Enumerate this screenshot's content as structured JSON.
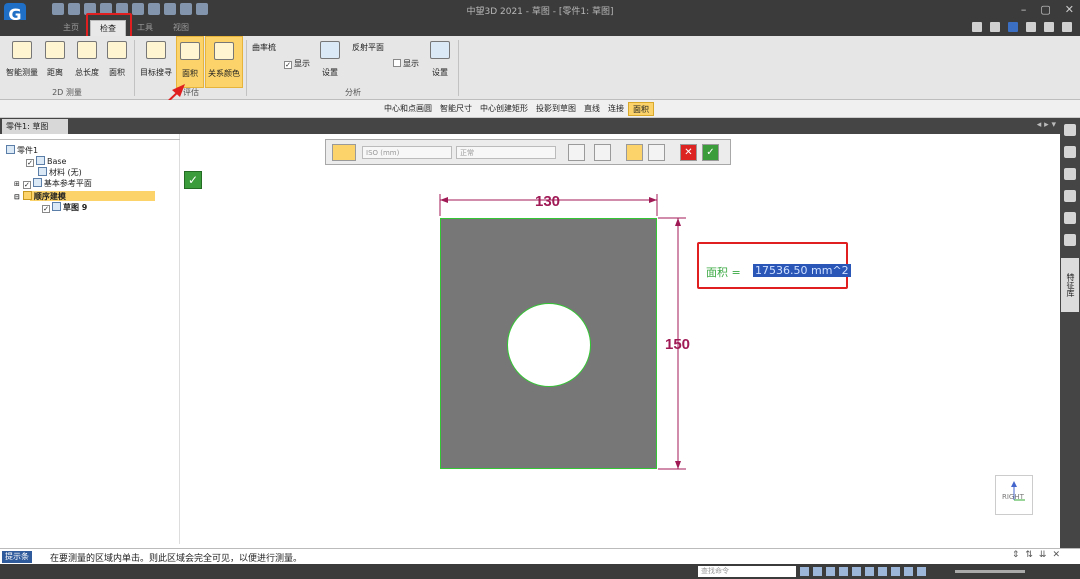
{
  "app": {
    "title": "中望3D 2021 - 草图 - [零件1: 草图]",
    "logo_text": "G",
    "tabs": [
      "主页",
      "检查",
      "工具",
      "视图"
    ],
    "active_tab": "检查"
  },
  "ribbon": {
    "measure_group": {
      "label": "2D 测量",
      "buttons": [
        "智能测量",
        "距离",
        "总长度",
        "面积"
      ]
    },
    "eval_group": {
      "label": "评估",
      "buttons": [
        "目标搜寻",
        "面积",
        "关系颜色"
      ]
    },
    "analysis_group": {
      "label": "分析",
      "curvature_label": "曲率梳",
      "curvature_show": "显示",
      "curvature_settings": "设置",
      "reflect_label": "反射平面",
      "reflect_show": "显示",
      "reflect_settings": "设置"
    }
  },
  "command_bar": {
    "items": [
      "中心和点画圆",
      "智能尺寸",
      "中心创建矩形",
      "投影到草图",
      "直线",
      "连接",
      "面积"
    ],
    "active": "面积"
  },
  "document": {
    "tab_label": "零件1: 草图"
  },
  "tree": {
    "root": "零件1",
    "items": [
      {
        "label": "Base"
      },
      {
        "label": "材料 (无)"
      },
      {
        "label": "基本参考平面"
      },
      {
        "label": "顺序建模"
      },
      {
        "label": "草图 9"
      }
    ]
  },
  "float_toolbar": {
    "standard_select": "ISO (mm)",
    "style_select": "正常"
  },
  "canvas": {
    "dimension_width": "130",
    "dimension_height": "150",
    "area_label": "面积 =",
    "area_value": "17536.50 mm^2",
    "view_label": "RIGHT"
  },
  "right_panel": {
    "feature_lib": "特征库"
  },
  "prompt": {
    "tag": "提示条",
    "text": "在要测量的区域内单击。则此区域会完全可见，以便进行测量。"
  },
  "status": {
    "command_search_placeholder": "查找命令"
  },
  "colors": {
    "highlight": "#fbd36a",
    "dimension": "#a01a56",
    "accept_green": "#3a9c3a",
    "annotation_red": "#e02020"
  }
}
